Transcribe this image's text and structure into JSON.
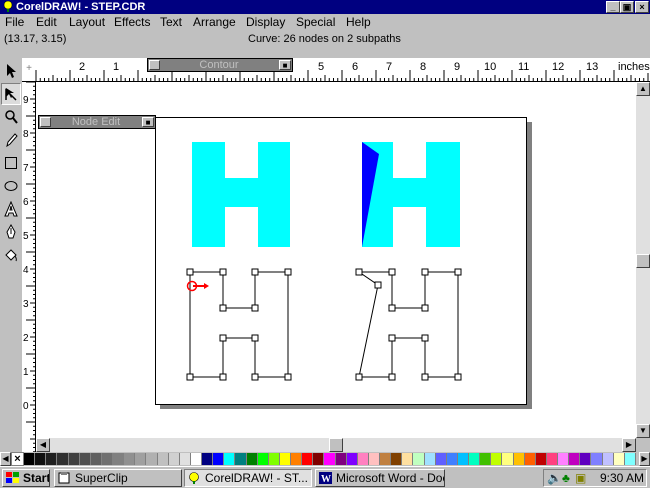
{
  "window": {
    "title": "CorelDRAW! - STEP.CDR",
    "minimize_label": "_",
    "restore_label": "▣",
    "close_label": "×"
  },
  "menu": {
    "items": [
      "File",
      "Edit",
      "Layout",
      "Effects",
      "Text",
      "Arrange",
      "Display",
      "Special",
      "Help"
    ]
  },
  "status": {
    "coords": "(13.17,  3.15)",
    "info": "Curve: 26 nodes on 2 subpaths"
  },
  "ruler": {
    "h_numbers": [
      "3",
      "2",
      "1",
      "4",
      "5",
      "6",
      "7",
      "8",
      "9",
      "10",
      "11",
      "12",
      "13"
    ],
    "unit": "inches",
    "v_numbers": [
      "9",
      "8",
      "7",
      "6",
      "5",
      "4",
      "3",
      "2",
      "1",
      "0"
    ]
  },
  "toolbars": {
    "contour_label": "Contour",
    "node_edit_label": "Node Edit"
  },
  "tools": [
    {
      "name": "pick",
      "icon": "pick-arrow-icon"
    },
    {
      "name": "shape",
      "icon": "shape-tool-icon"
    },
    {
      "name": "zoom",
      "icon": "zoom-icon"
    },
    {
      "name": "pencil",
      "icon": "pencil-icon"
    },
    {
      "name": "rectangle",
      "icon": "rectangle-icon"
    },
    {
      "name": "ellipse",
      "icon": "ellipse-icon"
    },
    {
      "name": "text",
      "icon": "text-icon"
    },
    {
      "name": "outline",
      "icon": "outline-pen-icon"
    },
    {
      "name": "fill",
      "icon": "fill-bucket-icon"
    }
  ],
  "palette": {
    "none_label": "×",
    "colors": [
      "#000000",
      "#101010",
      "#202020",
      "#303030",
      "#404040",
      "#505050",
      "#606060",
      "#707070",
      "#808080",
      "#909090",
      "#a0a0a0",
      "#b0b0b0",
      "#c0c0c0",
      "#d0d0d0",
      "#e0e0e0",
      "#ffffff",
      "#000080",
      "#0000ff",
      "#00ffff",
      "#008080",
      "#008000",
      "#00ff00",
      "#80ff00",
      "#ffff00",
      "#ff8000",
      "#ff0000",
      "#800000",
      "#ff00ff",
      "#800080",
      "#8000ff",
      "#ff80c0",
      "#ffc0c0",
      "#c08040",
      "#804000",
      "#ffe0a0",
      "#c0ffc0",
      "#a0e0ff",
      "#6060ff",
      "#4080ff",
      "#00c0ff",
      "#00ffc0",
      "#40c000",
      "#c0ff00",
      "#ffff80",
      "#ffc000",
      "#ff6000",
      "#c00000",
      "#ff4080",
      "#ff80ff",
      "#c000c0",
      "#6000c0",
      "#8080ff",
      "#c0c0ff",
      "#ffffc0",
      "#80ffff"
    ]
  },
  "taskbar": {
    "start_label": "Start",
    "items": [
      {
        "label": "SuperClip",
        "icon": "superclip-icon"
      },
      {
        "label": "CorelDRAW! - ST...",
        "icon": "coreldraw-icon"
      },
      {
        "label": "Microsoft Word - Doc...",
        "icon": "word-icon"
      }
    ],
    "time": "9:30 AM"
  },
  "colors": {
    "cyan_fill": "#00ffff",
    "blue_fill": "#0000ff",
    "title_bar": "#000080",
    "node_marker": "#ff0000"
  }
}
